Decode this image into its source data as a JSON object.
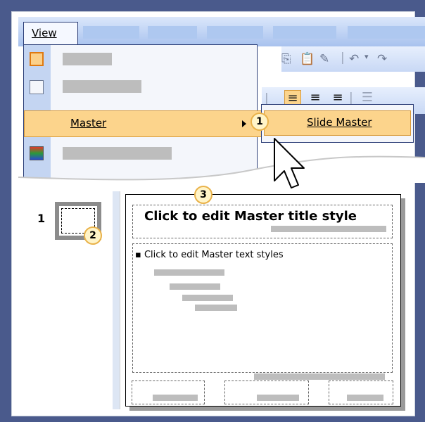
{
  "menu": {
    "view_label": "View",
    "master_label": "Master",
    "slide_master_label": "Slide Master"
  },
  "callouts": {
    "one": "1",
    "two": "2",
    "three": "3"
  },
  "slide_pane": {
    "slide_number": "1"
  },
  "slide": {
    "title": "Click to edit Master title style",
    "body_bullet": "▪ Click to edit Master text styles"
  },
  "colors": {
    "frame_border": "#4a5a8c",
    "menu_highlight": "#fcd48c",
    "callout_fill": "#fff4c8",
    "menubar": "#a8c2ee"
  },
  "icons": {
    "toolbar": [
      "paste-icon",
      "format-painter-icon",
      "undo-icon",
      "align-left-icon",
      "align-center-icon",
      "align-right-icon",
      "numbered-list-icon"
    ],
    "menu": [
      "normal-view-icon",
      "slide-sorter-icon",
      "color-grayscale-icon"
    ]
  }
}
